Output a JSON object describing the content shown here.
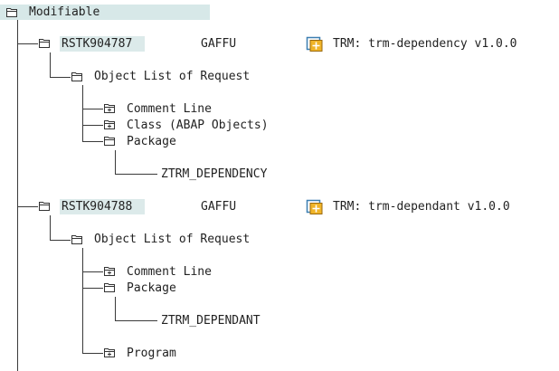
{
  "tree": {
    "root": {
      "label": "Modifiable",
      "icon": "folder-open-icon"
    },
    "requests": [
      {
        "id": "RSTK904787",
        "owner": "GAFFU",
        "description": "TRM: trm-dependency v1.0.0",
        "object_list": {
          "label": "Object List of Request",
          "items": [
            {
              "label": "Comment Line",
              "icon": "folder-closed-icon"
            },
            {
              "label": "Class (ABAP Objects)",
              "icon": "folder-closed-icon"
            },
            {
              "label": "Package",
              "icon": "folder-open-icon",
              "children": [
                "ZTRM_DEPENDENCY"
              ]
            }
          ]
        }
      },
      {
        "id": "RSTK904788",
        "owner": "GAFFU",
        "description": "TRM: trm-dependant v1.0.0",
        "object_list": {
          "label": "Object List of Request",
          "items": [
            {
              "label": "Comment Line",
              "icon": "folder-closed-icon"
            },
            {
              "label": "Package",
              "icon": "folder-open-icon",
              "children": [
                "ZTRM_DEPENDANT"
              ]
            },
            {
              "label": "Program",
              "icon": "folder-closed-icon"
            }
          ]
        }
      }
    ]
  },
  "colors": {
    "row_highlight": "#d7e8e8",
    "trm_icon_border": "#3c7fb1",
    "trm_icon_fill": "#f0b428",
    "line": "#3a3a3a"
  }
}
